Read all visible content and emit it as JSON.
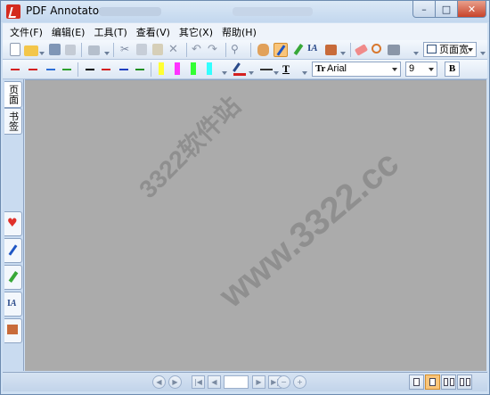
{
  "window": {
    "title": "PDF Annotator",
    "controls": {
      "minimize": "–",
      "maximize": "□",
      "close": "✕"
    }
  },
  "menu": [
    {
      "label": "文件(F)"
    },
    {
      "label": "编辑(E)"
    },
    {
      "label": "工具(T)"
    },
    {
      "label": "查看(V)"
    },
    {
      "label": "其它(X)"
    },
    {
      "label": "帮助(H)"
    }
  ],
  "toolbar": {
    "zoom_label": "页面宽",
    "font_name": "Arial",
    "font_size": "9",
    "bold_label": "B",
    "font_prefix": "Tr"
  },
  "line_colors": [
    "#d42020",
    "#d42020",
    "#2d6fd6",
    "#2ea02e"
  ],
  "pen_colors": [
    "#000000",
    "#d42020",
    "#1f3fbf",
    "#208f20"
  ],
  "highlight_colors": [
    "#ffff33",
    "#ff33ff",
    "#33ff33",
    "#33ffff"
  ],
  "sidepanel": {
    "tab_pages": "页面",
    "tab_bookmarks": "书签"
  },
  "watermark": {
    "line1": "3322软件站",
    "line2": "www.3322.cc"
  },
  "statusbar": {
    "page_value": ""
  }
}
